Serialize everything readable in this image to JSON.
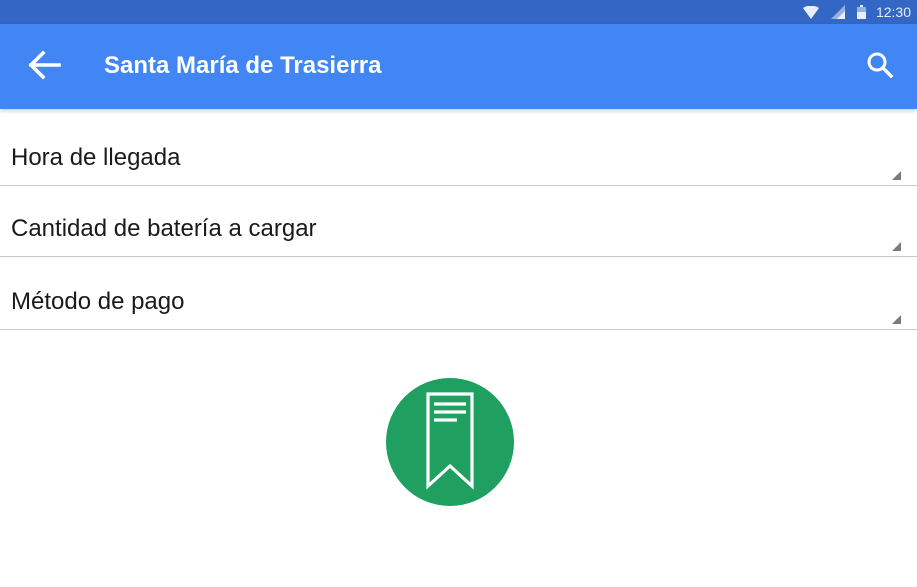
{
  "status_bar": {
    "time": "12:30",
    "icons": [
      "wifi-icon",
      "signal-icon",
      "battery-icon"
    ],
    "color": "#3467c4"
  },
  "app_bar": {
    "title": "Santa María de Trasierra",
    "back_icon": "arrow-back-icon",
    "search_icon": "search-icon",
    "color": "#4285f4"
  },
  "form": {
    "fields": [
      {
        "label": "Hora de llegada"
      },
      {
        "label": "Cantidad de batería a cargar"
      },
      {
        "label": "Método de pago"
      }
    ]
  },
  "fab": {
    "icon": "receipt-bookmark-icon",
    "color": "#1fa061"
  }
}
